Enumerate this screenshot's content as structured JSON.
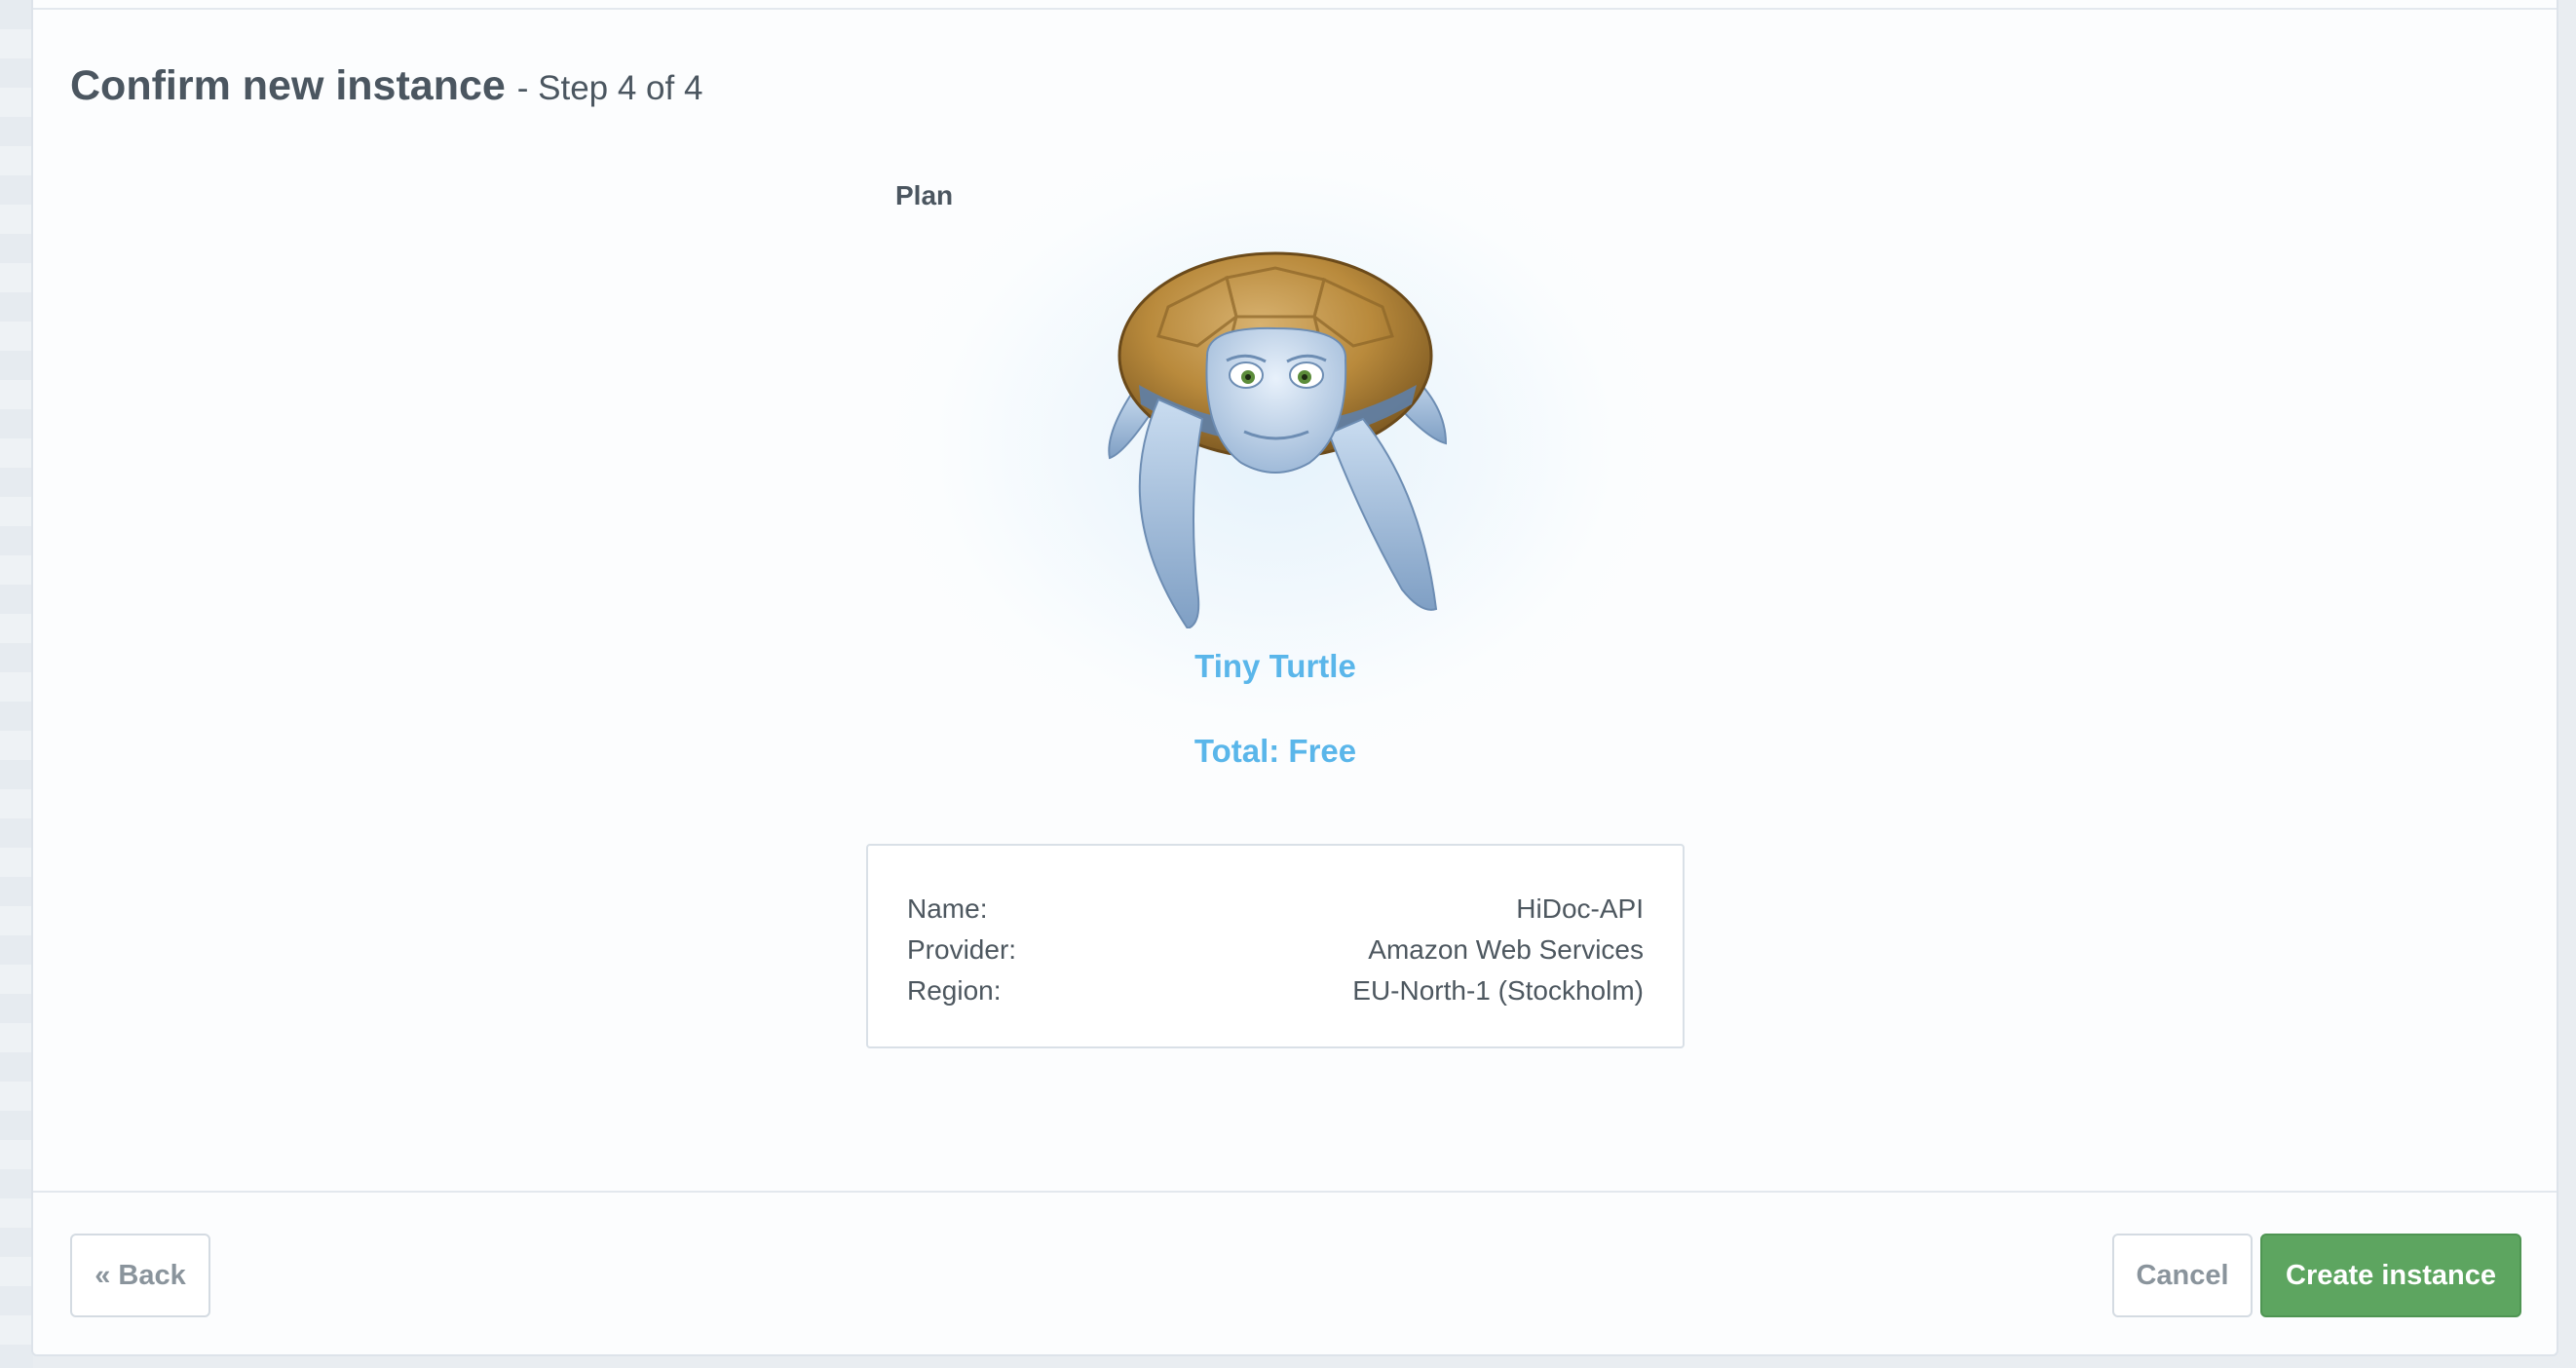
{
  "page": {
    "title": "Confirm new instance",
    "step": "- Step 4 of 4"
  },
  "plan": {
    "section_label": "Plan",
    "image_icon": "tiny-turtle-mascot",
    "name": "Tiny Turtle",
    "total": "Total: Free"
  },
  "summary": {
    "rows": [
      {
        "label": "Name:",
        "value": "HiDoc-API"
      },
      {
        "label": "Provider:",
        "value": "Amazon Web Services"
      },
      {
        "label": "Region:",
        "value": "EU-North-1 (Stockholm)"
      }
    ]
  },
  "footer": {
    "back_label": "« Back",
    "cancel_label": "Cancel",
    "create_label": "Create instance"
  },
  "colors": {
    "accent": "#5ab6ea",
    "primary_button": "#5da560",
    "text": "#4b5660"
  }
}
